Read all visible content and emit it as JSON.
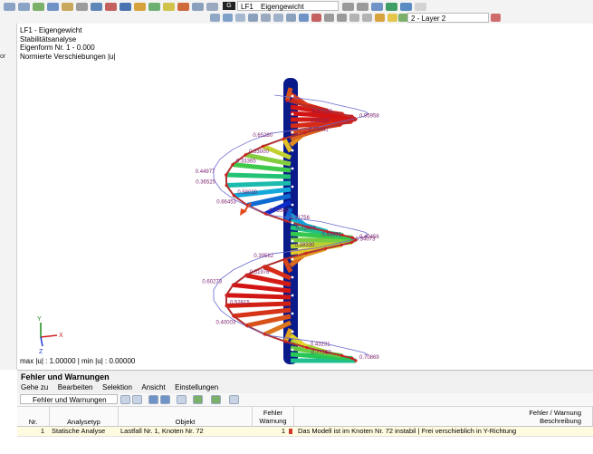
{
  "toolbar": {
    "loadcase_badge": "G",
    "loadcase_code": "LF1",
    "loadcase_name": "Eigengewicht",
    "layer": "2 - Layer 2"
  },
  "left_panel": {
    "cut_text": "or"
  },
  "viewport": {
    "info_lines": [
      "LF1 - Eigengewicht",
      "Stabilitätsanalyse",
      "Eigenform Nr. 1 - 0.000",
      "Normierte Verschiebungen |u|"
    ],
    "minmax": "max |u| : 1.00000 | min |u| : 0.00000",
    "axis_x": "X",
    "axis_y": "Y",
    "axis_z": "Z",
    "value_labels": [
      "0.87120",
      "0.95958",
      "0.91119",
      "0.73441",
      "0.65280",
      "0.53000",
      "0.44977",
      "0.58030",
      "0.66453",
      "0.73560",
      "0.72495",
      "0.33365",
      "0.36520",
      "0.31756",
      "0.46861",
      "0.40456",
      "0.28330",
      "0.34073",
      "0.39562",
      "0.51976",
      "0.60273",
      "0.52615",
      "0.40003",
      "0.43231",
      "0.77369",
      "0.70869"
    ]
  },
  "panel": {
    "title": "Fehler und Warnungen",
    "menu": [
      "Gehe zu",
      "Bearbeiten",
      "Selektion",
      "Ansicht",
      "Einstellungen"
    ],
    "filter_value": "Fehler und Warnungen",
    "columns": {
      "nr": "Nr.",
      "analysetyp": "Analysetyp",
      "objekt": "Objekt",
      "fehler_l1": "Fehler",
      "fehler_l2": "Warnung",
      "beschr_l1": "Fehler / Warnung",
      "beschr_l2": "Beschreibung"
    },
    "rows": [
      {
        "nr": "1",
        "analysetyp": "Statische Analyse",
        "objekt": "Lastfall Nr. 1, Knoten Nr. 72",
        "fehler": "1",
        "beschreibung": "Das Modell ist im Knoten Nr. 72 instabil | Frei verschieblich in Y-Richtung"
      }
    ]
  }
}
